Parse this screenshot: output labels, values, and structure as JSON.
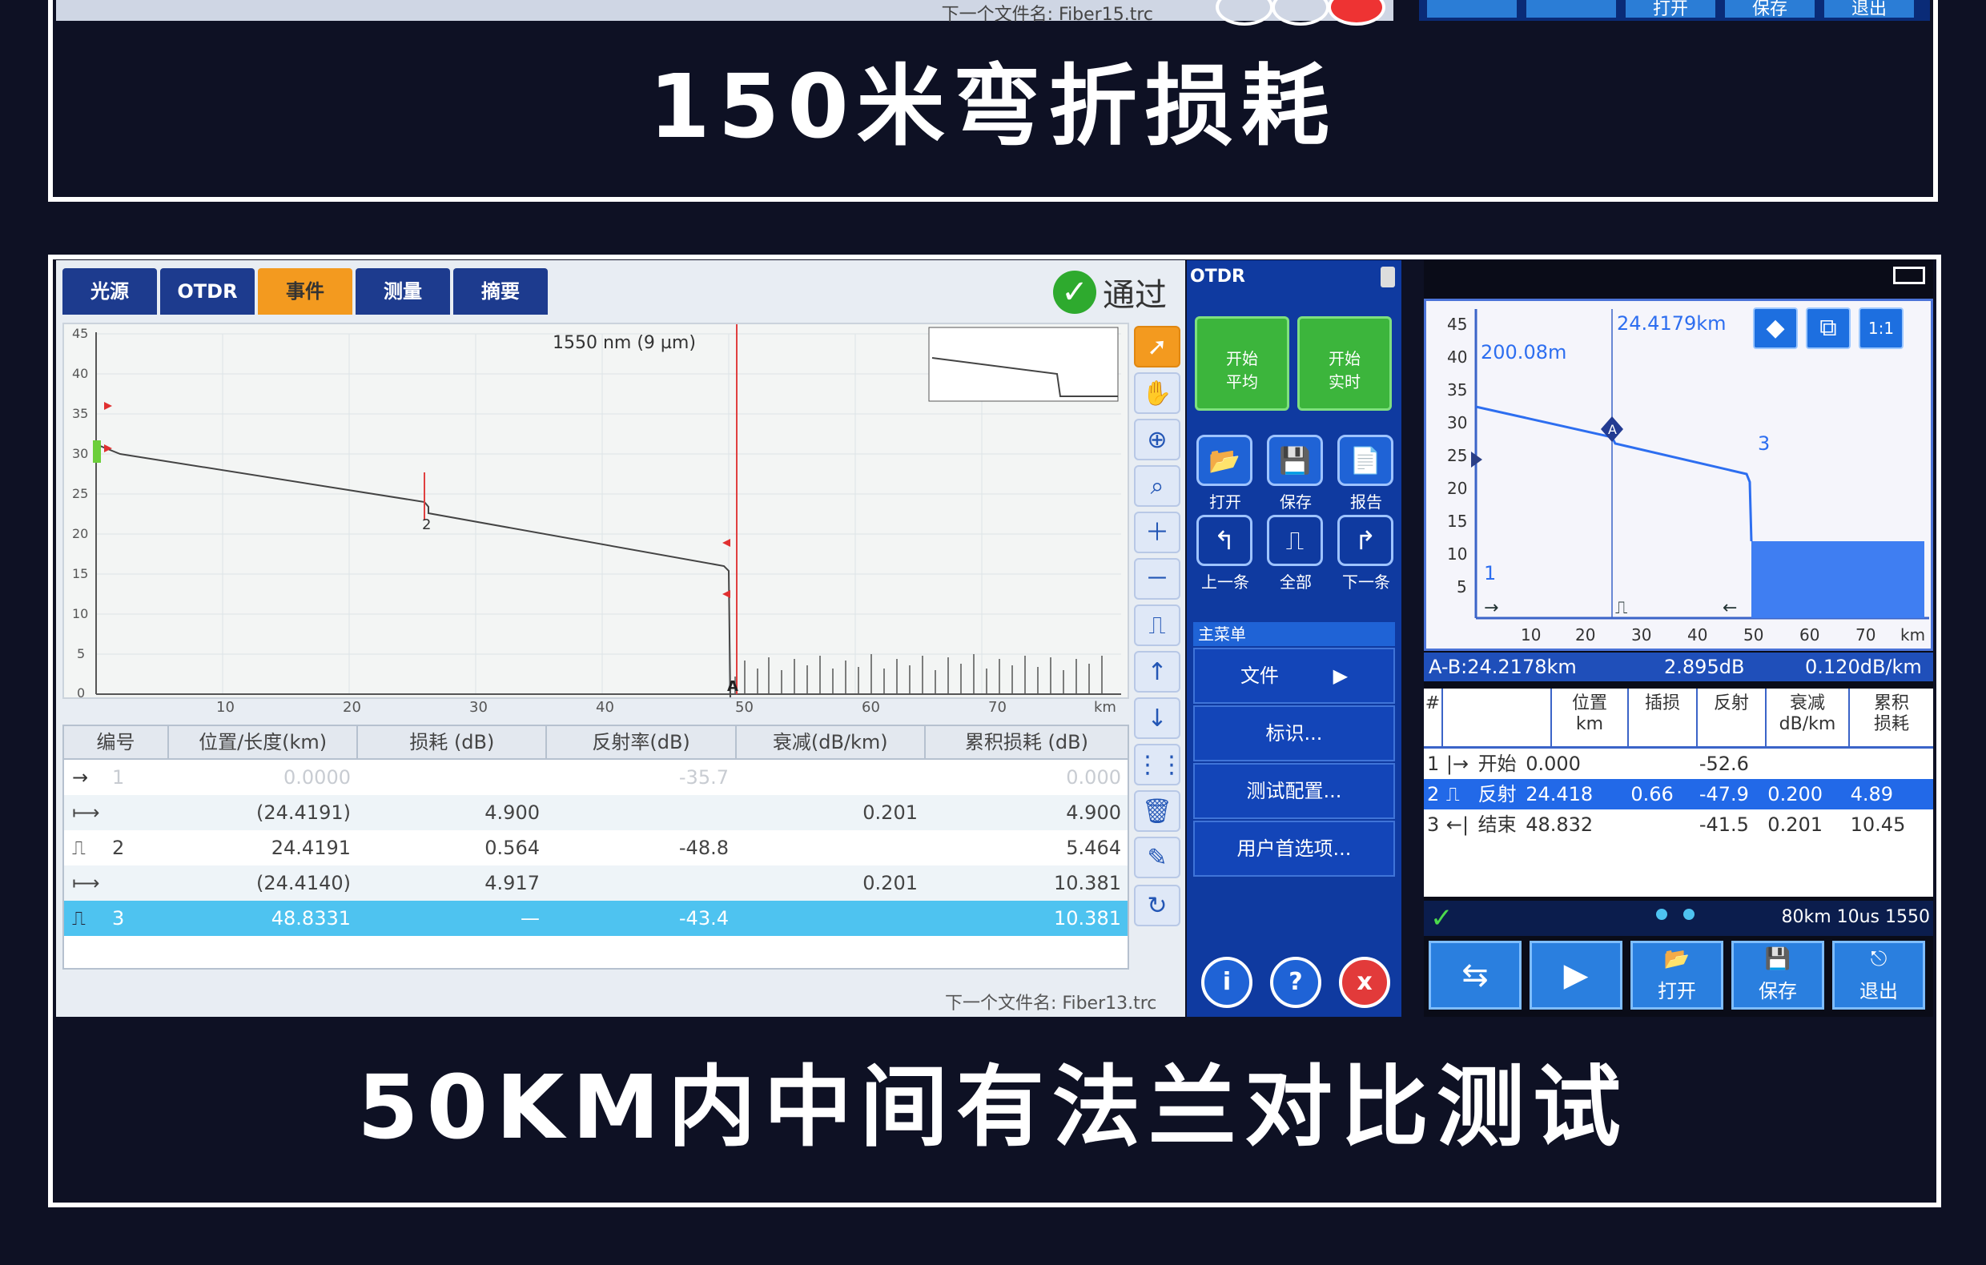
{
  "captions": {
    "top": "150米弯折损耗",
    "bottom": "50KM内中间有法兰对比测试"
  },
  "top_strip": {
    "next_file": "下一个文件名: Fiber15.trc",
    "buttons": [
      "",
      "",
      "打开",
      "保存",
      "退出"
    ]
  },
  "left_screen": {
    "tabs": [
      "光源",
      "OTDR",
      "事件",
      "测量",
      "摘要"
    ],
    "active_tab": "事件",
    "pass_label": "通过",
    "graph": {
      "wavelength_label": "1550 nm (9 µm)",
      "y_ticks": [
        "45",
        "40",
        "35",
        "30",
        "25",
        "20",
        "15",
        "10",
        "5",
        "0"
      ],
      "x_ticks": [
        "10",
        "20",
        "30",
        "40",
        "50",
        "60",
        "70",
        "km"
      ],
      "marker_a": "A",
      "event_label": "2"
    },
    "table": {
      "headers": [
        "编号",
        "位置/长度(km)",
        "损耗 (dB)",
        "反射率(dB)",
        "衰减(dB/km)",
        "累积损耗 (dB)"
      ],
      "rows": [
        {
          "icon": "→",
          "no": "1",
          "pos": "0.0000",
          "loss": "",
          "refl": "-35.7",
          "atten": "",
          "cum": "0.000"
        },
        {
          "icon": "⟼",
          "no": "",
          "pos": "(24.4191)",
          "loss": "4.900",
          "refl": "",
          "atten": "0.201",
          "cum": "4.900"
        },
        {
          "icon": "⎍",
          "no": "2",
          "pos": "24.4191",
          "loss": "0.564",
          "refl": "-48.8",
          "atten": "",
          "cum": "5.464"
        },
        {
          "icon": "⟼",
          "no": "",
          "pos": "(24.4140)",
          "loss": "4.917",
          "refl": "",
          "atten": "0.201",
          "cum": "10.381"
        },
        {
          "icon": "⎍",
          "no": "3",
          "pos": "48.8331",
          "loss": "—",
          "refl": "-43.4",
          "atten": "",
          "cum": "10.381"
        }
      ]
    },
    "next_file": "下一个文件名: Fiber13.trc"
  },
  "mid_panel": {
    "title": "OTDR",
    "green_buttons": [
      "开始\n平均",
      "开始\n实时"
    ],
    "icon_buttons": [
      {
        "label": "打开",
        "icon": "folder-icon"
      },
      {
        "label": "保存",
        "icon": "save-icon"
      },
      {
        "label": "报告",
        "icon": "report-icon"
      },
      {
        "label": "上一条",
        "icon": "prev-trace-icon"
      },
      {
        "label": "全部",
        "icon": "all-traces-icon"
      },
      {
        "label": "下一条",
        "icon": "next-trace-icon"
      }
    ],
    "menu_header": "主菜单",
    "menu_items": [
      "文件",
      "标识...",
      "测试配置...",
      "用户首选项..."
    ],
    "bottom_buttons": [
      "i",
      "?",
      "x"
    ]
  },
  "right_screen": {
    "graph": {
      "distance_label": "24.4179km",
      "left_label": "200.08m",
      "y_ticks": [
        "45",
        "40",
        "35",
        "30",
        "25",
        "20",
        "15",
        "10",
        "5"
      ],
      "x_ticks": [
        "10",
        "20",
        "30",
        "40",
        "50",
        "60",
        "70",
        "km"
      ],
      "marker_a": "A",
      "marker_3": "3",
      "marker_1": "1"
    },
    "ab_bar": {
      "ab": "A-B:24.2178km",
      "loss": "2.895dB",
      "atten": "0.120dB/km"
    },
    "table": {
      "headers": [
        "#",
        "",
        "位置\nkm",
        "插损",
        "反射",
        "衰减\ndB/km",
        "累积\n损耗"
      ],
      "rows": [
        {
          "no": "1",
          "icon": "|→",
          "type": "开始",
          "pos": "0.000",
          "ins": "",
          "refl": "-52.6",
          "atten": "",
          "cum": ""
        },
        {
          "no": "2",
          "icon": "⎍",
          "type": "反射",
          "pos": "24.418",
          "ins": "0.66",
          "refl": "-47.9",
          "atten": "0.200",
          "cum": "4.89"
        },
        {
          "no": "3",
          "icon": "←|",
          "type": "结束",
          "pos": "48.832",
          "ins": "",
          "refl": "-41.5",
          "atten": "0.201",
          "cum": "10.45"
        }
      ]
    },
    "status": "80km 10us 1550",
    "buttons": [
      "",
      "",
      "打开",
      "保存",
      "退出"
    ]
  }
}
